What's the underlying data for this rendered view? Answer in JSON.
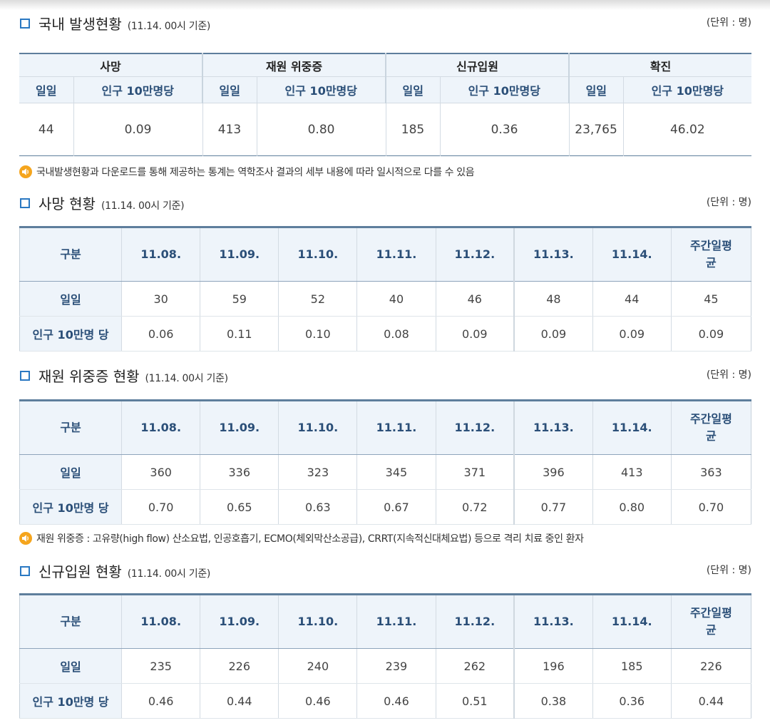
{
  "section1": {
    "title": "국내 발생현황",
    "sub": "(11.14. 00시 기준)",
    "unit": "(단위 : 명)",
    "groups": [
      "사망",
      "재원 위중증",
      "신규입원",
      "확진"
    ],
    "subheaders": [
      "일일",
      "인구 10만명당",
      "일일",
      "인구 10만명당",
      "일일",
      "인구 10만명당",
      "일일",
      "인구 10만명당"
    ],
    "values": [
      "44",
      "0.09",
      "413",
      "0.80",
      "185",
      "0.36",
      "23,765",
      "46.02"
    ],
    "note": "국내발생현황과 다운로드를 통해 제공하는 통계는 역학조사 결과의 세부 내용에 따라 일시적으로 다를 수 있음"
  },
  "columns": [
    "구분",
    "11.08.",
    "11.09.",
    "11.10.",
    "11.11.",
    "11.12.",
    "11.13.",
    "11.14.",
    "주간일평\n균"
  ],
  "death": {
    "title": "사망 현황",
    "sub": "(11.14. 00시 기준)",
    "unit": "(단위 : 명)",
    "rows": [
      {
        "label": "일일",
        "values": [
          "30",
          "59",
          "52",
          "40",
          "46",
          "48",
          "44",
          "45"
        ]
      },
      {
        "label": "인구 10만명 당",
        "values": [
          "0.06",
          "0.11",
          "0.10",
          "0.08",
          "0.09",
          "0.09",
          "0.09",
          "0.09"
        ]
      }
    ]
  },
  "severe": {
    "title": "재원 위중증 현황",
    "sub": "(11.14. 00시 기준)",
    "unit": "(단위 : 명)",
    "rows": [
      {
        "label": "일일",
        "values": [
          "360",
          "336",
          "323",
          "345",
          "371",
          "396",
          "413",
          "363"
        ]
      },
      {
        "label": "인구 10만명 당",
        "values": [
          "0.70",
          "0.65",
          "0.63",
          "0.67",
          "0.72",
          "0.77",
          "0.80",
          "0.70"
        ]
      }
    ],
    "note": "재원 위중증 : 고유량(high flow) 산소요법, 인공호흡기, ECMO(체외막산소공급), CRRT(지속적신대체요법) 등으로 격리 치료 중인 환자"
  },
  "admission": {
    "title": "신규입원 현황",
    "sub": "(11.14. 00시 기준)",
    "unit": "(단위 : 명)",
    "rows": [
      {
        "label": "일일",
        "values": [
          "235",
          "226",
          "240",
          "239",
          "262",
          "196",
          "185",
          "226"
        ]
      },
      {
        "label": "인구 10만명 당",
        "values": [
          "0.46",
          "0.44",
          "0.46",
          "0.46",
          "0.51",
          "0.38",
          "0.36",
          "0.44"
        ]
      }
    ]
  }
}
